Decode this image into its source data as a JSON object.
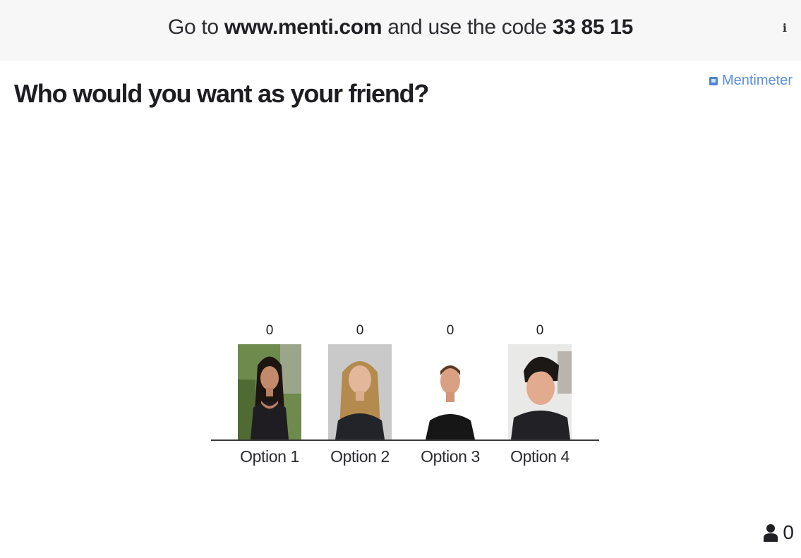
{
  "header": {
    "prefix": "Go to",
    "url": "www.menti.com",
    "middle": "and use the code",
    "code": "33 85 15",
    "info_glyph": "i"
  },
  "slide": {
    "question": "Who would you want as your friend?",
    "brand": "Mentimeter"
  },
  "options": [
    {
      "label": "Option 1",
      "votes": "0"
    },
    {
      "label": "Option 2",
      "votes": "0"
    },
    {
      "label": "Option 3",
      "votes": "0"
    },
    {
      "label": "Option 4",
      "votes": "0"
    }
  ],
  "footer": {
    "voter_count": "0"
  },
  "colors": {
    "brand": "#5a8fd8",
    "header_bg": "#f7f7f7",
    "axis": "#3a3a3a"
  },
  "icons": [
    "info-icon",
    "mentimeter-logo-icon",
    "person-icon"
  ]
}
